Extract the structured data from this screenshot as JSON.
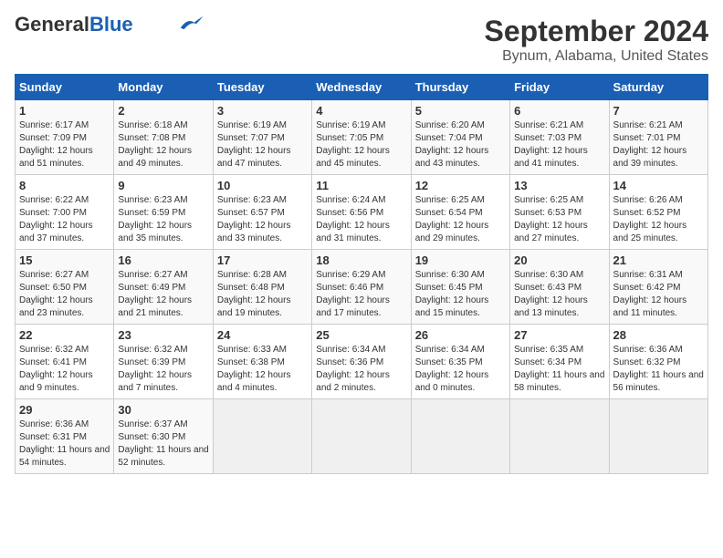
{
  "logo": {
    "general": "General",
    "blue": "Blue"
  },
  "title": "September 2024",
  "subtitle": "Bynum, Alabama, United States",
  "weekdays": [
    "Sunday",
    "Monday",
    "Tuesday",
    "Wednesday",
    "Thursday",
    "Friday",
    "Saturday"
  ],
  "weeks": [
    [
      {
        "day": "1",
        "sunrise": "6:17 AM",
        "sunset": "7:09 PM",
        "daylight": "12 hours and 51 minutes."
      },
      {
        "day": "2",
        "sunrise": "6:18 AM",
        "sunset": "7:08 PM",
        "daylight": "12 hours and 49 minutes."
      },
      {
        "day": "3",
        "sunrise": "6:19 AM",
        "sunset": "7:07 PM",
        "daylight": "12 hours and 47 minutes."
      },
      {
        "day": "4",
        "sunrise": "6:19 AM",
        "sunset": "7:05 PM",
        "daylight": "12 hours and 45 minutes."
      },
      {
        "day": "5",
        "sunrise": "6:20 AM",
        "sunset": "7:04 PM",
        "daylight": "12 hours and 43 minutes."
      },
      {
        "day": "6",
        "sunrise": "6:21 AM",
        "sunset": "7:03 PM",
        "daylight": "12 hours and 41 minutes."
      },
      {
        "day": "7",
        "sunrise": "6:21 AM",
        "sunset": "7:01 PM",
        "daylight": "12 hours and 39 minutes."
      }
    ],
    [
      {
        "day": "8",
        "sunrise": "6:22 AM",
        "sunset": "7:00 PM",
        "daylight": "12 hours and 37 minutes."
      },
      {
        "day": "9",
        "sunrise": "6:23 AM",
        "sunset": "6:59 PM",
        "daylight": "12 hours and 35 minutes."
      },
      {
        "day": "10",
        "sunrise": "6:23 AM",
        "sunset": "6:57 PM",
        "daylight": "12 hours and 33 minutes."
      },
      {
        "day": "11",
        "sunrise": "6:24 AM",
        "sunset": "6:56 PM",
        "daylight": "12 hours and 31 minutes."
      },
      {
        "day": "12",
        "sunrise": "6:25 AM",
        "sunset": "6:54 PM",
        "daylight": "12 hours and 29 minutes."
      },
      {
        "day": "13",
        "sunrise": "6:25 AM",
        "sunset": "6:53 PM",
        "daylight": "12 hours and 27 minutes."
      },
      {
        "day": "14",
        "sunrise": "6:26 AM",
        "sunset": "6:52 PM",
        "daylight": "12 hours and 25 minutes."
      }
    ],
    [
      {
        "day": "15",
        "sunrise": "6:27 AM",
        "sunset": "6:50 PM",
        "daylight": "12 hours and 23 minutes."
      },
      {
        "day": "16",
        "sunrise": "6:27 AM",
        "sunset": "6:49 PM",
        "daylight": "12 hours and 21 minutes."
      },
      {
        "day": "17",
        "sunrise": "6:28 AM",
        "sunset": "6:48 PM",
        "daylight": "12 hours and 19 minutes."
      },
      {
        "day": "18",
        "sunrise": "6:29 AM",
        "sunset": "6:46 PM",
        "daylight": "12 hours and 17 minutes."
      },
      {
        "day": "19",
        "sunrise": "6:30 AM",
        "sunset": "6:45 PM",
        "daylight": "12 hours and 15 minutes."
      },
      {
        "day": "20",
        "sunrise": "6:30 AM",
        "sunset": "6:43 PM",
        "daylight": "12 hours and 13 minutes."
      },
      {
        "day": "21",
        "sunrise": "6:31 AM",
        "sunset": "6:42 PM",
        "daylight": "12 hours and 11 minutes."
      }
    ],
    [
      {
        "day": "22",
        "sunrise": "6:32 AM",
        "sunset": "6:41 PM",
        "daylight": "12 hours and 9 minutes."
      },
      {
        "day": "23",
        "sunrise": "6:32 AM",
        "sunset": "6:39 PM",
        "daylight": "12 hours and 7 minutes."
      },
      {
        "day": "24",
        "sunrise": "6:33 AM",
        "sunset": "6:38 PM",
        "daylight": "12 hours and 4 minutes."
      },
      {
        "day": "25",
        "sunrise": "6:34 AM",
        "sunset": "6:36 PM",
        "daylight": "12 hours and 2 minutes."
      },
      {
        "day": "26",
        "sunrise": "6:34 AM",
        "sunset": "6:35 PM",
        "daylight": "12 hours and 0 minutes."
      },
      {
        "day": "27",
        "sunrise": "6:35 AM",
        "sunset": "6:34 PM",
        "daylight": "11 hours and 58 minutes."
      },
      {
        "day": "28",
        "sunrise": "6:36 AM",
        "sunset": "6:32 PM",
        "daylight": "11 hours and 56 minutes."
      }
    ],
    [
      {
        "day": "29",
        "sunrise": "6:36 AM",
        "sunset": "6:31 PM",
        "daylight": "11 hours and 54 minutes."
      },
      {
        "day": "30",
        "sunrise": "6:37 AM",
        "sunset": "6:30 PM",
        "daylight": "11 hours and 52 minutes."
      },
      null,
      null,
      null,
      null,
      null
    ]
  ],
  "labels": {
    "sunrise": "Sunrise:",
    "sunset": "Sunset:",
    "daylight": "Daylight:"
  }
}
